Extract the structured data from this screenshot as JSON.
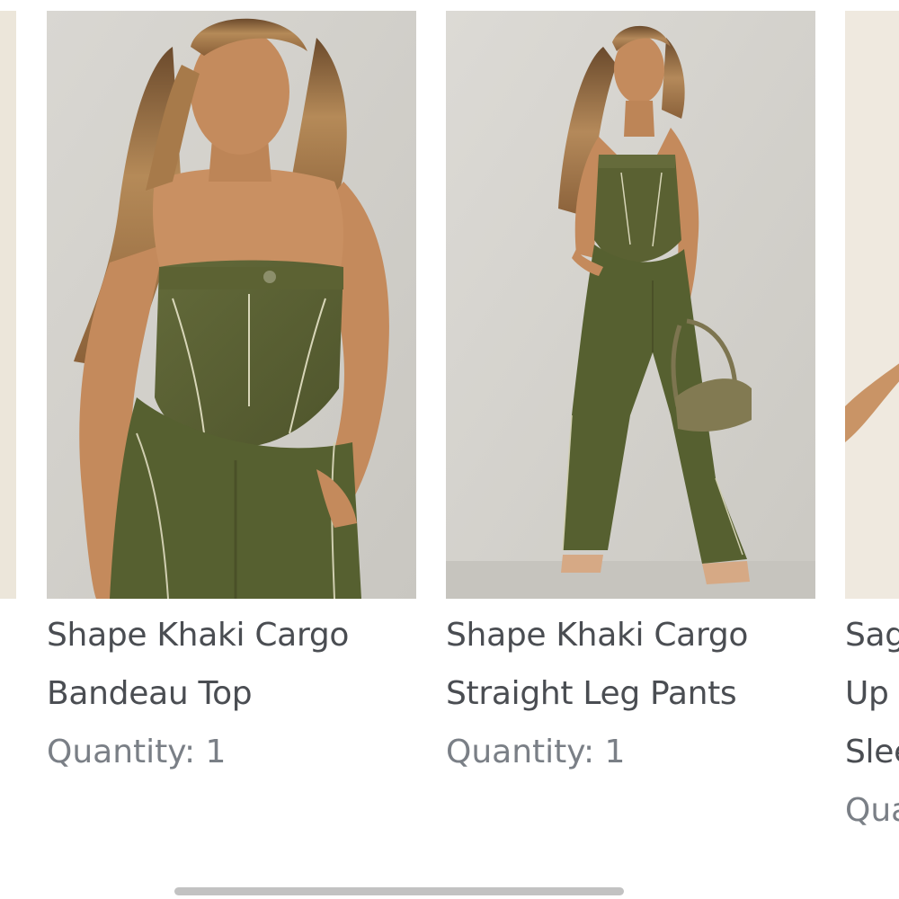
{
  "products": [
    {
      "name_line1": "Shape Khaki Cargo",
      "name_line2": "Bandeau Top",
      "quantity": "Quantity: 1"
    },
    {
      "name_line1": "Shape Khaki Cargo",
      "name_line2": "Straight Leg Pants",
      "quantity": "Quantity: 1"
    },
    {
      "name_line1": "Sag",
      "name_line2": "Up",
      "name_line3": "Slee",
      "quantity": "Qua"
    }
  ],
  "colors": {
    "background": "#ffffff",
    "name_text": "#4a4d52",
    "quantity_text": "#7a7f86",
    "khaki": "#5b6133",
    "wall": "#d3d1cb",
    "scrollbar": "#c2c2c2"
  }
}
